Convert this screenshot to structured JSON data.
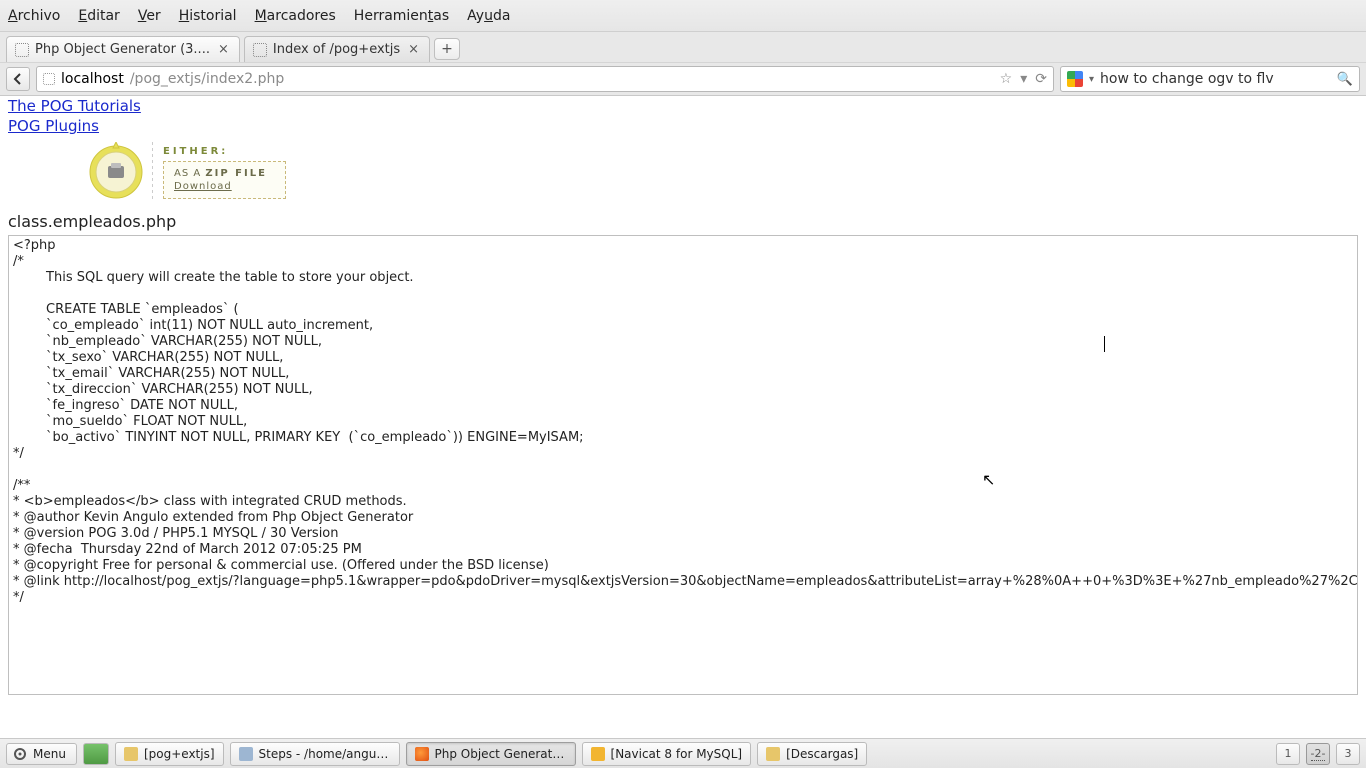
{
  "menubar": {
    "archivo": "Archivo",
    "editar": "Editar",
    "ver": "Ver",
    "historial": "Historial",
    "marcadores": "Marcadores",
    "herramientas": "Herramientas",
    "ayuda": "Ayuda"
  },
  "tabs": {
    "t1": "Php Object Generator (3....",
    "t2": "Index of /pog+extjs"
  },
  "url": {
    "host": "localhost",
    "path": "/pog_extjs/index2.php"
  },
  "search": {
    "placeholder": "",
    "value": "how to change ogv to flv"
  },
  "links": {
    "tutorials": "The POG Tutorials",
    "plugins": "POG Plugins"
  },
  "either": {
    "label": "EITHER:",
    "asa": "AS A ",
    "zip": "ZIP FILE",
    "download": "Download"
  },
  "classname": "class.empleados.php",
  "code": "<?php\n/*\n        This SQL query will create the table to store your object.\n\n        CREATE TABLE `empleados` (\n        `co_empleado` int(11) NOT NULL auto_increment,\n        `nb_empleado` VARCHAR(255) NOT NULL,\n        `tx_sexo` VARCHAR(255) NOT NULL,\n        `tx_email` VARCHAR(255) NOT NULL,\n        `tx_direccion` VARCHAR(255) NOT NULL,\n        `fe_ingreso` DATE NOT NULL,\n        `mo_sueldo` FLOAT NOT NULL,\n        `bo_activo` TINYINT NOT NULL, PRIMARY KEY  (`co_empleado`)) ENGINE=MyISAM;\n*/\n\n/**\n* <b>empleados</b> class with integrated CRUD methods.\n* @author Kevin Angulo extended from Php Object Generator\n* @version POG 3.0d / PHP5.1 MYSQL / 30 Version\n* @fecha  Thursday 22nd of March 2012 07:05:25 PM\n* @copyright Free for personal & commercial use. (Offered under the BSD license)\n* @link http://localhost/pog_extjs/?language=php5.1&wrapper=pdo&pdoDriver=mysql&extjsVersion=30&objectName=empleados&attributeList=array+%28%0A++0+%3D%3E+%27nb_empleado%27%2C%0A++1+%27%2C%0A++2+%3D%3E+%27tx_email%27%2C%0A++3+%3D%3E+%27tx_direccion%27%2C%0A++4+%3D%3E+%27fe_ingreso%27%2C%0A++5+%3D%3E+%27mo_sueldo%27%2C%0A++6+%3D%3E+%27bo_activo%27%2C%0A%29&typeL%2B%2528%250A%2B%2B0%2B%253D%253E%2B%2527VARCHAR%2528255%2529%2527%252C%250A%2B%2B1%2B%253D%253E%2B%2527VARCHAR%2528255%2529%2527%252C%250A%2B%2B2%2B%253D%253E%2B%2527VARCHAR%2528255%2529%2527%252C%250A%2B%2B3%2B%253D%253E%2B%2527VARCHAR%2528255%2529%2527%252C%250A%2B%2B4%2B%253D%253E%2B%2527DATE%2527%252C%250A%2B%2B5%2B%253D%253E%2B%2527FLOAT%2527%252C%250A%2B%2B6%2B%253D%253E%2B%2527TINYINT%2527%252C%250A%2529&renderList=array+%28%0A++0+%3D%3E+%27Ext.form.TextField%27%2C%0A++1+%3D%3E+%27Ext.form.ComboBox%2%3D%3E+%27Ext.form.TextField%27%2C%0A++3+%3D%3E+%27Ext.form.TextArea%27%2C%0A++4+%3D%3E+%27Ext.form.DateField%27%2C%0A++5+%3D%3E+%27Ext.form.TextField%27%2C%0A++6+%3D%3E+%27Ext.form%0A%29\n*/",
  "taskbar": {
    "menu": "Menu",
    "items": {
      "t1": "[pog+extjs]",
      "t2": "Steps - /home/angul...",
      "t3": "Php Object Generato...",
      "t4": "[Navicat 8 for MySQL]",
      "t5": "[Descargas]"
    },
    "ws": {
      "w1": "1",
      "w2": "2",
      "w3": "3"
    }
  }
}
